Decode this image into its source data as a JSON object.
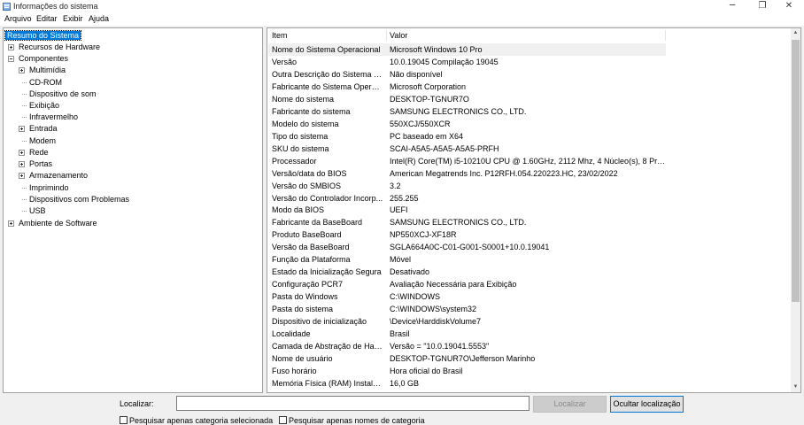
{
  "window": {
    "title": "Informações do sistema",
    "minimize": "─",
    "maximize": "❐",
    "close": "✕"
  },
  "menu": [
    "Arquivo",
    "Editar",
    "Exibir",
    "Ajuda"
  ],
  "tree": {
    "root": "Resumo do Sistema",
    "hardware": "Recursos de Hardware",
    "components": "Componentes",
    "children": [
      "Multimídia",
      "CD-ROM",
      "Dispositivo de som",
      "Exibição",
      "Infravermelho",
      "Entrada",
      "Modem",
      "Rede",
      "Portas",
      "Armazenamento",
      "Imprimindo",
      "Dispositivos com Problemas",
      "USB"
    ],
    "software": "Ambiente de Software"
  },
  "table": {
    "headers": {
      "item": "Item",
      "value": "Valor"
    },
    "rows": [
      {
        "item": "Nome do Sistema Operacional",
        "value": "Microsoft Windows 10 Pro"
      },
      {
        "item": "Versão",
        "value": "10.0.19045 Compilação 19045"
      },
      {
        "item": "Outra Descrição do Sistema O...",
        "value": "Não disponível"
      },
      {
        "item": "Fabricante do Sistema Operaci...",
        "value": "Microsoft Corporation"
      },
      {
        "item": "Nome do sistema",
        "value": "DESKTOP-TGNUR7O"
      },
      {
        "item": "Fabricante do sistema",
        "value": "SAMSUNG ELECTRONICS CO., LTD."
      },
      {
        "item": "Modelo do sistema",
        "value": "550XCJ/550XCR"
      },
      {
        "item": "Tipo do sistema",
        "value": "PC baseado em X64"
      },
      {
        "item": "SKU do sistema",
        "value": "SCAI-A5A5-A5A5-A5A5-PRFH"
      },
      {
        "item": "Processador",
        "value": "Intel(R) Core(TM) i5-10210U CPU @ 1.60GHz, 2112 Mhz, 4 Núcleo(s), 8 Proces..."
      },
      {
        "item": "Versão/data do BIOS",
        "value": "American Megatrends Inc. P12RFH.054.220223.HC, 23/02/2022"
      },
      {
        "item": "Versão do SMBIOS",
        "value": "3.2"
      },
      {
        "item": "Versão do Controlador Incorp...",
        "value": "255.255"
      },
      {
        "item": "Modo da BIOS",
        "value": "UEFI"
      },
      {
        "item": "Fabricante da BaseBoard",
        "value": "SAMSUNG ELECTRONICS CO., LTD."
      },
      {
        "item": "Produto BaseBoard",
        "value": "NP550XCJ-XF18R"
      },
      {
        "item": "Versão da BaseBoard",
        "value": "SGLA664A0C-C01-G001-S0001+10.0.19041"
      },
      {
        "item": "Função da Plataforma",
        "value": "Móvel"
      },
      {
        "item": "Estado da Inicialização Segura",
        "value": "Desativado"
      },
      {
        "item": "Configuração PCR7",
        "value": "Avaliação Necessária para Exibição"
      },
      {
        "item": "Pasta do Windows",
        "value": "C:\\WINDOWS"
      },
      {
        "item": "Pasta do sistema",
        "value": "C:\\WINDOWS\\system32"
      },
      {
        "item": "Dispositivo de inicialização",
        "value": "\\Device\\HarddiskVolume7"
      },
      {
        "item": "Localidade",
        "value": "Brasil"
      },
      {
        "item": "Camada de Abstração de Hard...",
        "value": "Versão = \"10.0.19041.5553\""
      },
      {
        "item": "Nome de usuário",
        "value": "DESKTOP-TGNUR7O\\Jefferson Marinho"
      },
      {
        "item": "Fuso horário",
        "value": "Hora oficial do Brasil"
      },
      {
        "item": "Memória Física (RAM) Instalada",
        "value": "16,0 GB"
      }
    ]
  },
  "scrollbar": {
    "up_arrow": "▲",
    "down_arrow": "▼"
  },
  "find": {
    "label": "Localizar:",
    "value": "",
    "find_button": "Localizar",
    "close_button": "Ocultar localização",
    "option_category": "Pesquisar apenas categoria selecionada",
    "option_names": "Pesquisar apenas nomes de categoria"
  }
}
